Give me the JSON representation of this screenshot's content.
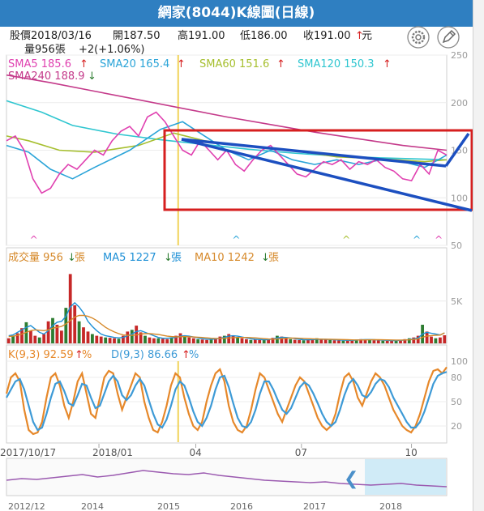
{
  "title": "網家(8044)K線圖(日線)",
  "info": {
    "date_label": "股價2018/03/16",
    "open": "開187.50",
    "high": "高191.00",
    "low": "低186.00",
    "close": "收191.00",
    "close_arrow": "↑",
    "unit": "元",
    "volume": "量956張",
    "change": "+2(+1.06%)"
  },
  "icons": {
    "settings": "gear-icon",
    "edit": "pencil-icon"
  },
  "colors": {
    "sma5": "#e040b0",
    "sma20": "#2aa4d8",
    "sma60": "#a6bf2e",
    "sma120": "#2fc6d0",
    "sma240": "#c43a8a",
    "annotation_red": "#d61f1f",
    "annotation_blue": "#1c4fc0",
    "volume_up": "#c62828",
    "volume_down": "#2e7d32",
    "ma5": "#1e90d6",
    "ma10": "#d6892a",
    "k_line": "#e6882a",
    "d_line": "#3d9ad6",
    "highlight": "#f1d35a"
  },
  "chart_data": [
    {
      "type": "line",
      "panel": "price",
      "ylim": [
        50,
        250
      ],
      "yticks": [
        "250",
        "200",
        "150",
        "100",
        "50"
      ],
      "grid": true,
      "legend": [
        {
          "label": "SMA5 185.6",
          "arrow": "↑"
        },
        {
          "label": "SMA20 165.4",
          "arrow": "↑"
        },
        {
          "label": "SMA60 151.6",
          "arrow": "↑"
        },
        {
          "label": "SMA120 150.3",
          "arrow": "↑"
        },
        {
          "label": "SMA240 188.9",
          "arrow": "↓"
        }
      ],
      "series": [
        {
          "name": "SMA240",
          "points": [
            [
              0,
              229
            ],
            [
              0.1,
              221
            ],
            [
              0.2,
              212
            ],
            [
              0.3,
              203
            ],
            [
              0.4,
              194
            ],
            [
              0.5,
              185
            ],
            [
              0.6,
              177
            ],
            [
              0.7,
              169
            ],
            [
              0.8,
              162
            ],
            [
              0.9,
              155
            ],
            [
              1.0,
              150
            ]
          ]
        },
        {
          "name": "SMA120",
          "points": [
            [
              0,
              202
            ],
            [
              0.08,
              190
            ],
            [
              0.15,
              176
            ],
            [
              0.25,
              167
            ],
            [
              0.35,
              161
            ],
            [
              0.45,
              156
            ],
            [
              0.55,
              151
            ],
            [
              0.65,
              147
            ],
            [
              0.75,
              144
            ],
            [
              0.85,
              142
            ],
            [
              1.0,
              140
            ]
          ]
        },
        {
          "name": "SMA60",
          "points": [
            [
              0,
              165
            ],
            [
              0.05,
              160
            ],
            [
              0.12,
              150
            ],
            [
              0.2,
              148
            ],
            [
              0.3,
              155
            ],
            [
              0.38,
              168
            ],
            [
              0.45,
              160
            ],
            [
              0.55,
              154
            ],
            [
              0.65,
              150
            ],
            [
              0.75,
              143
            ],
            [
              0.85,
              141
            ],
            [
              0.95,
              138
            ],
            [
              1.0,
              140
            ]
          ]
        },
        {
          "name": "SMA20",
          "points": [
            [
              0,
              155
            ],
            [
              0.05,
              148
            ],
            [
              0.1,
              130
            ],
            [
              0.15,
              120
            ],
            [
              0.2,
              132
            ],
            [
              0.28,
              150
            ],
            [
              0.35,
              172
            ],
            [
              0.4,
              180
            ],
            [
              0.45,
              165
            ],
            [
              0.5,
              150
            ],
            [
              0.55,
              140
            ],
            [
              0.6,
              150
            ],
            [
              0.65,
              140
            ],
            [
              0.7,
              135
            ],
            [
              0.75,
              140
            ],
            [
              0.8,
              135
            ],
            [
              0.85,
              140
            ],
            [
              0.9,
              138
            ],
            [
              0.95,
              132
            ],
            [
              1.0,
              145
            ]
          ]
        },
        {
          "name": "SMA5",
          "points": [
            [
              0,
              160
            ],
            [
              0.02,
              165
            ],
            [
              0.04,
              150
            ],
            [
              0.06,
              120
            ],
            [
              0.08,
              105
            ],
            [
              0.1,
              110
            ],
            [
              0.12,
              125
            ],
            [
              0.14,
              135
            ],
            [
              0.16,
              130
            ],
            [
              0.18,
              140
            ],
            [
              0.2,
              150
            ],
            [
              0.22,
              145
            ],
            [
              0.24,
              160
            ],
            [
              0.26,
              170
            ],
            [
              0.28,
              175
            ],
            [
              0.3,
              165
            ],
            [
              0.32,
              185
            ],
            [
              0.34,
              190
            ],
            [
              0.36,
              180
            ],
            [
              0.38,
              165
            ],
            [
              0.4,
              150
            ],
            [
              0.42,
              145
            ],
            [
              0.44,
              160
            ],
            [
              0.46,
              150
            ],
            [
              0.48,
              140
            ],
            [
              0.5,
              150
            ],
            [
              0.52,
              135
            ],
            [
              0.54,
              128
            ],
            [
              0.56,
              140
            ],
            [
              0.58,
              150
            ],
            [
              0.6,
              155
            ],
            [
              0.62,
              145
            ],
            [
              0.64,
              135
            ],
            [
              0.66,
              125
            ],
            [
              0.68,
              122
            ],
            [
              0.7,
              130
            ],
            [
              0.72,
              138
            ],
            [
              0.74,
              135
            ],
            [
              0.76,
              140
            ],
            [
              0.78,
              130
            ],
            [
              0.8,
              138
            ],
            [
              0.82,
              135
            ],
            [
              0.84,
              140
            ],
            [
              0.86,
              132
            ],
            [
              0.88,
              128
            ],
            [
              0.9,
              120
            ],
            [
              0.92,
              118
            ],
            [
              0.94,
              135
            ],
            [
              0.96,
              125
            ],
            [
              0.98,
              150
            ],
            [
              1.0,
              145
            ]
          ]
        }
      ],
      "markers_x": [
        0.06,
        0.52,
        0.77,
        0.93,
        0.98
      ],
      "highlight_x": 0.39
    },
    {
      "type": "bar",
      "panel": "volume",
      "legend": [
        {
          "label": "成交量 956",
          "arrow": "↓",
          "unit": "張"
        },
        {
          "label": "MA5 1227",
          "arrow": "↓",
          "unit": "張"
        },
        {
          "label": "MA10 1242",
          "arrow": "↓",
          "unit": "張"
        }
      ],
      "yticks": [
        "5K"
      ],
      "ylim": [
        0,
        9000
      ],
      "bars": [
        600,
        900,
        1200,
        1800,
        2500,
        1500,
        900,
        700,
        1100,
        2600,
        3000,
        2200,
        1500,
        4200,
        8200,
        4500,
        2600,
        1900,
        1400,
        1100,
        900,
        800,
        700,
        650,
        600,
        550,
        900,
        1400,
        1600,
        2100,
        1300,
        900,
        700,
        600,
        600,
        550,
        500,
        700,
        900,
        1200,
        900,
        700,
        600,
        500,
        450,
        400,
        450,
        600,
        800,
        900,
        1100,
        900,
        700,
        600,
        500,
        400,
        450,
        380,
        420,
        500,
        650,
        900,
        800,
        600,
        500,
        420,
        380,
        360,
        420,
        500,
        600,
        550,
        450,
        380,
        360,
        340,
        320,
        340,
        400,
        450,
        500,
        450,
        400,
        360,
        340,
        320,
        300,
        320,
        360,
        420,
        500,
        600,
        700,
        900,
        2200,
        1400,
        800,
        600,
        700,
        956
      ],
      "ma5": [
        900,
        1000,
        1300,
        1600,
        1900,
        2100,
        1700,
        1300,
        1100,
        1500,
        2100,
        2500,
        2600,
        3200,
        4300,
        4800,
        4300,
        3600,
        2600,
        2000,
        1500,
        1100,
        900,
        800,
        700,
        650,
        700,
        900,
        1100,
        1400,
        1500,
        1300,
        1100,
        900,
        700,
        600,
        600,
        650,
        700,
        850,
        900,
        850,
        750,
        650,
        550,
        500,
        480,
        520,
        600,
        700,
        850,
        900,
        850,
        750,
        650,
        550,
        480,
        450,
        430,
        440,
        520,
        640,
        720,
        700,
        640,
        560,
        480,
        430,
        420,
        440,
        470,
        490,
        480,
        450,
        420,
        400,
        370,
        350,
        350,
        380,
        420,
        450,
        450,
        430,
        400,
        370,
        350,
        330,
        330,
        350,
        390,
        450,
        530,
        640,
        1100,
        1300,
        1200,
        1100,
        1000,
        1227
      ],
      "ma10": [
        800,
        850,
        950,
        1100,
        1300,
        1500,
        1600,
        1550,
        1500,
        1600,
        1800,
        1900,
        2000,
        2300,
        2700,
        3100,
        3300,
        3300,
        3200,
        3000,
        2700,
        2300,
        1900,
        1600,
        1350,
        1150,
        1000,
        950,
        950,
        1000,
        1100,
        1150,
        1150,
        1100,
        1050,
        950,
        850,
        800,
        780,
        780,
        800,
        780,
        760,
        730,
        700,
        650,
        600,
        580,
        580,
        600,
        640,
        680,
        700,
        700,
        700,
        680,
        650,
        600,
        560,
        520,
        500,
        520,
        560,
        600,
        620,
        620,
        600,
        580,
        560,
        540,
        520,
        500,
        490,
        480,
        470,
        460,
        450,
        430,
        410,
        400,
        400,
        410,
        420,
        430,
        430,
        420,
        410,
        400,
        390,
        390,
        400,
        420,
        460,
        520,
        720,
        860,
        920,
        960,
        980,
        1242
      ]
    },
    {
      "type": "line",
      "panel": "kd",
      "legend": [
        {
          "label": "K(9,3) 92.59",
          "arrow": "↑",
          "unit": "%"
        },
        {
          "label": "D(9,3) 86.66",
          "arrow": "↑",
          "unit": "%"
        }
      ],
      "ylim": [
        0,
        100
      ],
      "yticks": [
        "100",
        "80",
        "50",
        "20"
      ],
      "series": [
        {
          "name": "K",
          "values": [
            60,
            80,
            85,
            75,
            40,
            15,
            10,
            12,
            25,
            55,
            80,
            85,
            70,
            45,
            30,
            50,
            75,
            85,
            60,
            35,
            30,
            55,
            80,
            88,
            85,
            60,
            40,
            55,
            70,
            85,
            80,
            50,
            30,
            15,
            12,
            25,
            45,
            70,
            85,
            80,
            55,
            35,
            20,
            15,
            25,
            50,
            70,
            85,
            90,
            75,
            45,
            25,
            15,
            12,
            20,
            40,
            65,
            85,
            80,
            65,
            50,
            35,
            25,
            40,
            55,
            70,
            80,
            75,
            60,
            45,
            30,
            20,
            15,
            20,
            35,
            60,
            80,
            85,
            75,
            55,
            45,
            60,
            75,
            85,
            80,
            70,
            55,
            40,
            30,
            20,
            15,
            12,
            20,
            35,
            55,
            75,
            88,
            90,
            85,
            92.59
          ]
        },
        {
          "name": "D",
          "values": [
            55,
            65,
            75,
            78,
            65,
            45,
            25,
            15,
            18,
            35,
            55,
            72,
            75,
            63,
            48,
            45,
            58,
            72,
            70,
            55,
            42,
            45,
            60,
            75,
            82,
            75,
            58,
            52,
            58,
            70,
            78,
            70,
            52,
            35,
            22,
            18,
            28,
            45,
            65,
            75,
            70,
            55,
            38,
            25,
            20,
            30,
            45,
            65,
            80,
            82,
            68,
            48,
            30,
            20,
            18,
            25,
            40,
            60,
            75,
            75,
            65,
            52,
            40,
            35,
            42,
            55,
            68,
            74,
            70,
            60,
            48,
            35,
            25,
            20,
            25,
            40,
            58,
            72,
            78,
            70,
            58,
            55,
            62,
            72,
            78,
            76,
            68,
            55,
            45,
            35,
            25,
            18,
            18,
            25,
            38,
            55,
            72,
            82,
            85,
            86.66
          ]
        }
      ],
      "highlight_x": 0.39
    }
  ],
  "x_axis": {
    "labels": [
      "2017/10/17",
      "2018/01",
      "04",
      "07",
      "10"
    ]
  },
  "navigator": {
    "labels": [
      "2012/12",
      "2014",
      "2015",
      "2016",
      "2017",
      "2018"
    ],
    "arrow": "❮",
    "values": [
      18,
      20,
      19,
      21,
      23,
      25,
      22,
      24,
      27,
      30,
      28,
      26,
      25,
      27,
      24,
      22,
      20,
      18,
      17,
      16,
      15,
      16,
      14,
      13,
      12,
      13,
      14,
      12,
      11,
      10
    ]
  }
}
